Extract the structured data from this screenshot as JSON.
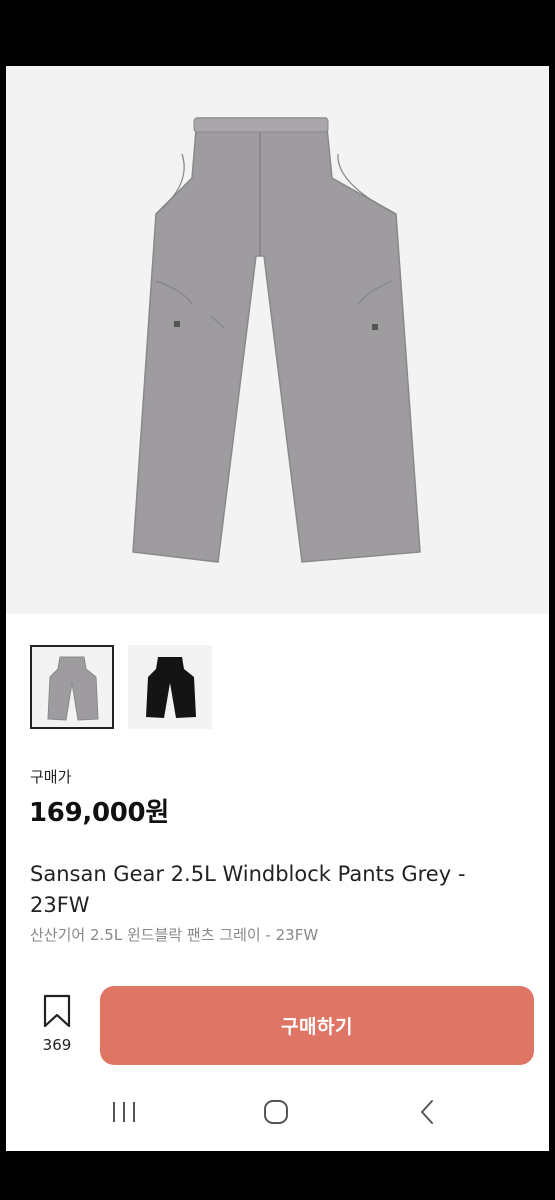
{
  "product": {
    "price_label": "구매가",
    "price": "169,000원",
    "title": "Sansan Gear 2.5L Windblock Pants Grey  - 23FW",
    "subtitle": "산산기어 2.5L 윈드블락 팬츠 그레이 - 23FW"
  },
  "hero_image": {
    "name": "grey-pants-photo",
    "color": "#9e9c9f"
  },
  "thumbnails": [
    {
      "name": "grey-pants-thumbnail",
      "color": "#9e9c9f",
      "selected": true
    },
    {
      "name": "black-pants-thumbnail",
      "color": "#141414",
      "selected": false
    }
  ],
  "wishlist": {
    "count": "369",
    "icon": "bookmark-icon"
  },
  "buy_button": {
    "label": "구매하기",
    "color": "#de7565"
  },
  "system_nav": {
    "icons": [
      "recent-apps-icon",
      "home-icon",
      "back-icon"
    ]
  }
}
